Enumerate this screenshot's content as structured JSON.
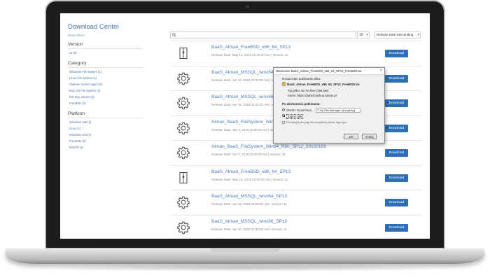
{
  "sidebar": {
    "title": "Download Center",
    "reset_filters": "Reset filters",
    "version": {
      "title": "Version",
      "items": [
        "11 (8)"
      ]
    },
    "category": {
      "title": "Category",
      "items": [
        "Windows File System (1)",
        "Linux File System (1)",
        "VMware Server Agent (8)",
        "Mac OS File System (1)",
        "MS SQL Server (2)",
        "FreeBSD (2)"
      ]
    },
    "platform": {
      "title": "Platform",
      "items": [
        "Windows x86 (3)",
        "Linux (1)",
        "Windows x64 (3)",
        "FreeBSD (2)",
        "MacOS (1)"
      ]
    }
  },
  "toolbar": {
    "search_placeholder": "",
    "per_page": "10",
    "sort": "Release Date Descending"
  },
  "downloads": [
    {
      "icon": "file-archive-icon",
      "title": "BaaS_Atman_FreeBSD_x86_64_SP13",
      "meta": "Release Date: May 16, 2019 02:00:00 AM  |   Version: 11",
      "button": "Download"
    },
    {
      "icon": "gear-icon",
      "title": "BaaS_Atman_MSSQL_winx64_SP13",
      "meta": "Release Date: Apr 18, 2019 02:00:00 AM  |   Version: 11",
      "button": "Download"
    },
    {
      "icon": "gear-icon",
      "title": "BaaS_Atman_MSSQL_winx86_SP13",
      "meta": "Release Date: Apr 18, 2019 02:00:00 AM  |   Version: 11",
      "button": "Download"
    },
    {
      "icon": "gear-icon",
      "title": "Atman_BaaS_FileSystem_Win32_R80",
      "meta": "Release Date: Jan 3, 2019 12:00:00 AM  |   Version: 11",
      "button": "Download"
    },
    {
      "icon": "gear-icon",
      "title": "Atman_BaaS_FileSystem_Win64_R80_SP12_20190103",
      "meta": "Release Date: Jan 3, 2019 12:00:00 AM  |   Version: 11",
      "button": "Download"
    },
    {
      "icon": "file-archive-icon",
      "title": "BaaS_Atman_FreeBSD_x86_64_SP13",
      "meta": "Release Date: May 16, 2019 02:00:00 AM  |   Version: 11",
      "button": "Download"
    },
    {
      "icon": "gear-icon",
      "title": "BaaS_Atman_MSSQL_winx64_SP13",
      "meta": "Release Date: Apr 18, 2019 02:00:00 AM  |   Version: 11",
      "button": "Download"
    },
    {
      "icon": "gear-icon",
      "title": "BaaS_Atman_MSSQL_winx86_SP13",
      "meta": "Release Date: Apr 18, 2019 02:00:00 AM  |   Version: 11",
      "button": "Download"
    }
  ],
  "dialog": {
    "title": "Otwieranie BaaS_Atman_FreeBSD_x86_64_SP13_FreeBSD.tar",
    "intro": "Rozpoczęto pobieranie pliku:",
    "filename": "BaaS_Atman_FreeBSD_x86_64_SP13_FreeBSD.tar",
    "type": "Typ pliku: tar Archive (258 MB)",
    "address": "Adres: https://panel.backup.atman.pl",
    "question": "Po ukończeniu pobierania:",
    "open_with": "Otwórz za pomocą",
    "app": "7-Zip File Manager (domyślny)",
    "save": "Zapisz plik",
    "remember": "Pamiętaj tę decyzję dla wszystkich plików tego typu",
    "ok": "OK",
    "cancel": "Anuluj"
  },
  "colors": {
    "accent": "#2f6fb5",
    "link": "#4a7bbd"
  }
}
